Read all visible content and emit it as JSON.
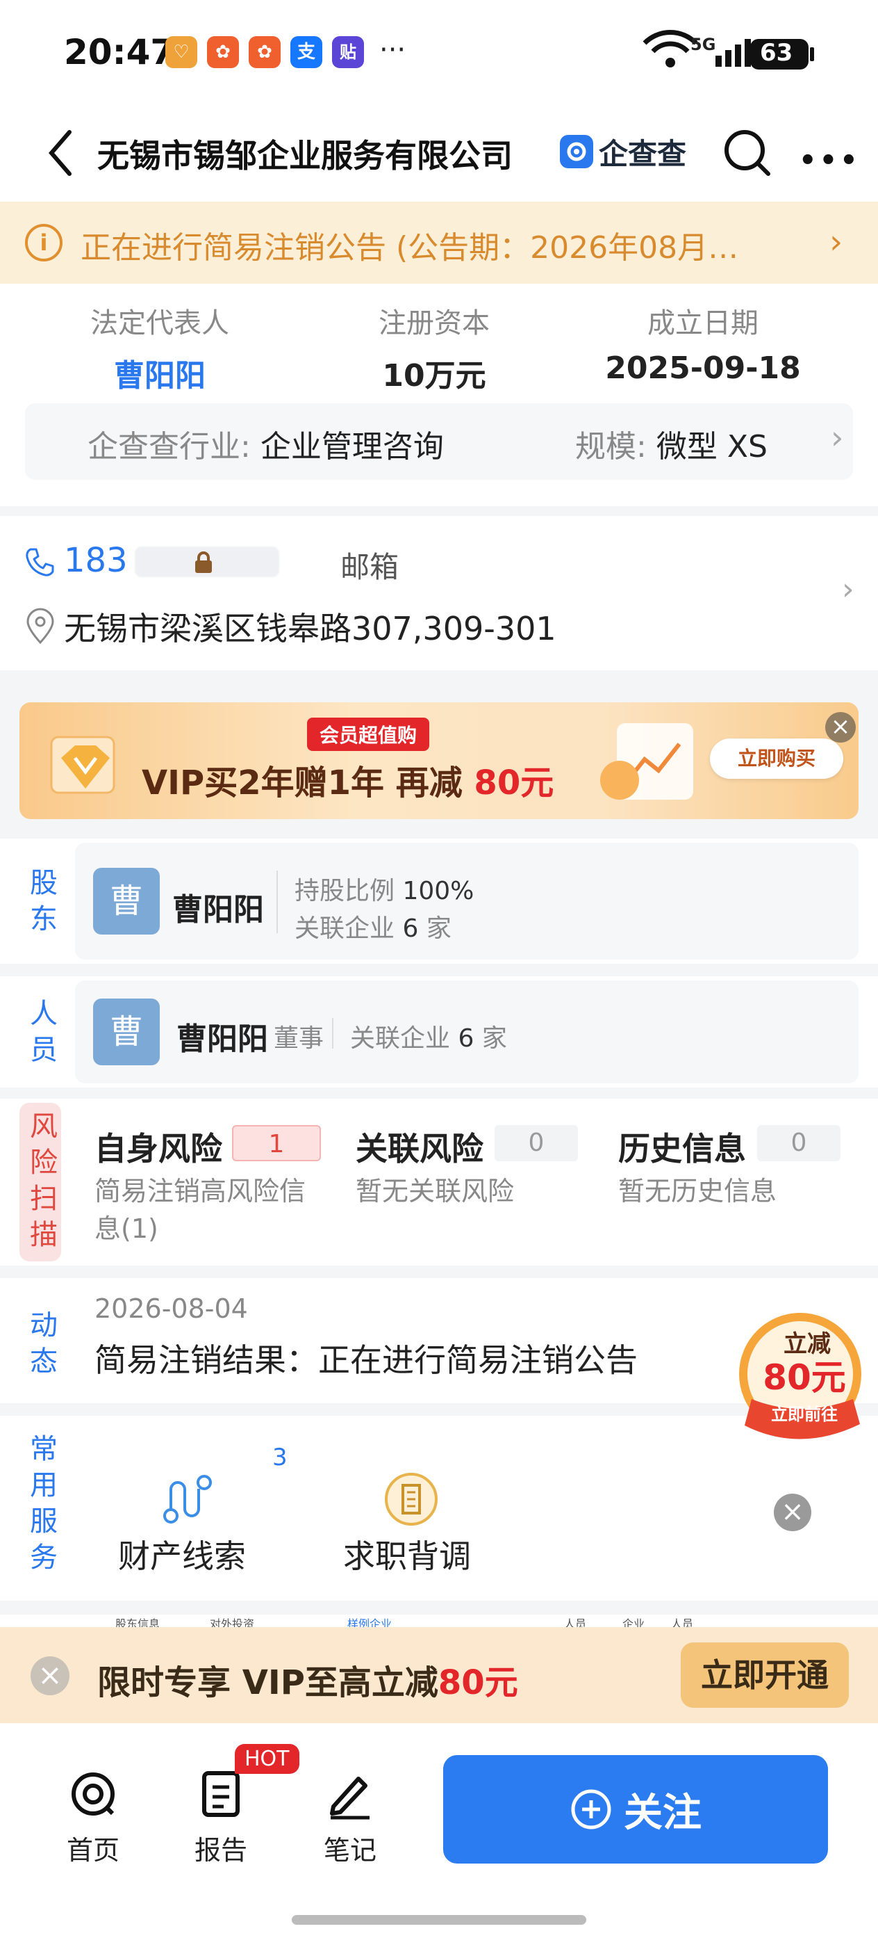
{
  "status_bar": {
    "time": "20:47",
    "battery": "63",
    "network": "5G",
    "app_icons": [
      {
        "name": "heart-app-icon",
        "color": "#f0a23a",
        "glyph": "♡"
      },
      {
        "name": "app-icon-2",
        "color": "#f0602e",
        "glyph": "✿"
      },
      {
        "name": "app-icon-3",
        "color": "#f0602e",
        "glyph": "✿"
      },
      {
        "name": "alipay-icon",
        "color": "#1677ff",
        "glyph": "支"
      },
      {
        "name": "tieba-icon",
        "color": "#5a45d6",
        "glyph": "贴"
      }
    ],
    "more": "···"
  },
  "nav": {
    "title": "无锡市锡邹企业服务有限公司",
    "brand": "企查查"
  },
  "notice": {
    "text": "正在进行简易注销公告 (公告期：2026年08月…"
  },
  "info": {
    "legal_rep_label": "法定代表人",
    "legal_rep_value": "曹阳阳",
    "capital_label": "注册资本",
    "capital_value": "10万元",
    "founded_label": "成立日期",
    "founded_value": "2025-09-18",
    "industry_label": "企查查行业:",
    "industry_value": "企业管理咨询",
    "scale_label": "规模:",
    "scale_value": "微型 XS"
  },
  "contact": {
    "phone": "183",
    "email_label": "邮箱",
    "address": "无锡市梁溪区钱皋路307,309-301"
  },
  "banner": {
    "tag": "会员超值购",
    "main_prefix": "VIP买2年赠1年  再减 ",
    "main_amount": "80元",
    "button": "立即购买"
  },
  "shareholder": {
    "label": "股东",
    "avatar": "曹",
    "name": "曹阳阳",
    "ratio_label": "持股比例",
    "ratio_value": "100%",
    "related_label": "关联企业",
    "related_value": "6",
    "related_unit": "家"
  },
  "staff": {
    "label": "人员",
    "avatar": "曹",
    "name": "曹阳阳",
    "role": "董事",
    "related_label": "关联企业",
    "related_value": "6",
    "related_unit": "家"
  },
  "risk": {
    "label": "风险扫描",
    "items": [
      {
        "title": "自身风险",
        "count": "1",
        "desc": "简易注销高风险信息(1)"
      },
      {
        "title": "关联风险",
        "count": "0",
        "desc": "暂无关联风险"
      },
      {
        "title": "历史信息",
        "count": "0",
        "desc": "暂无历史信息"
      }
    ]
  },
  "dynamic": {
    "label": "动态",
    "date": "2026-08-04",
    "text": "简易注销结果：正在进行简易注销公告"
  },
  "promo_badge": {
    "top": "立减",
    "amount": "80元",
    "bottom": "立即前往"
  },
  "services": {
    "label": "常用服务",
    "items": [
      {
        "label": "财产线索",
        "count": "3"
      },
      {
        "label": "求职背调"
      }
    ]
  },
  "peek": {
    "items": [
      "股东信息",
      "对外投资",
      "样例企业",
      "人员",
      "企业",
      "人员"
    ]
  },
  "bottom_promo": {
    "text_prefix": "限时专享  VIP至高立减",
    "amount": "80元",
    "button": "立即开通"
  },
  "tabbar": {
    "home": "首页",
    "report": "报告",
    "notes": "笔记",
    "hot": "HOT",
    "follow": "关注"
  },
  "colors": {
    "accent": "#2a78ee",
    "warning": "#d88a2e",
    "risk": "#e0483f",
    "promo_red": "#e3262a"
  }
}
